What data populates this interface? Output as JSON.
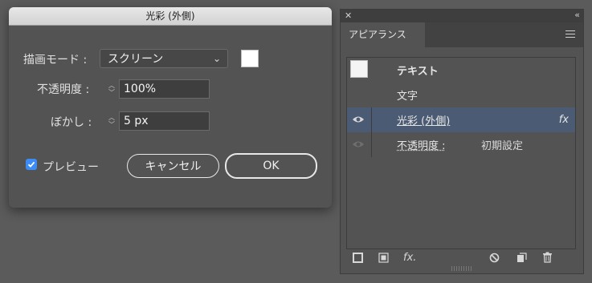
{
  "dialog": {
    "title": "光彩 (外側)",
    "mode_label": "描画モード :",
    "mode_value": "スクリーン",
    "opacity_label": "不透明度 :",
    "opacity_value": "100%",
    "blur_label": "ぼかし :",
    "blur_value": "5 px",
    "preview_label": "プレビュー",
    "preview_checked": true,
    "cancel_label": "キャンセル",
    "ok_label": "OK",
    "glow_color": "#ffffff",
    "checkbox_color": "#3d8cf5"
  },
  "panel": {
    "tab_label": "アピアランス",
    "rows": [
      {
        "label": "テキスト"
      },
      {
        "label": "文字"
      },
      {
        "label": "光彩 (外側)",
        "fx": "fx"
      },
      {
        "label": "不透明度 :",
        "setting": "初期設定"
      }
    ],
    "selected_color": "#4b5b73",
    "bottom_fx": "fx."
  }
}
